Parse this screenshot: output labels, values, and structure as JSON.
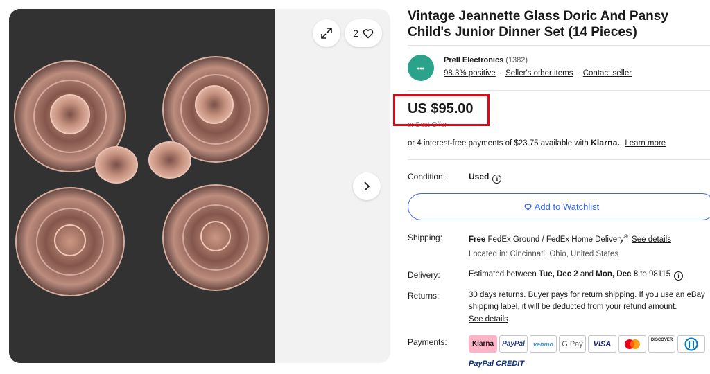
{
  "gallery": {
    "watch_count": "2",
    "icons": {
      "expand": "expand-icon",
      "heart": "heart-icon",
      "next": "chevron-right-icon"
    }
  },
  "listing": {
    "title": "Vintage Jeannette Glass Doric And Pansy Child's Junior Dinner Set (14 Pieces)"
  },
  "seller": {
    "name": "Prell Electronics",
    "feedback_count": "(1382)",
    "positive": "98.3% positive",
    "other_items": "Seller's other items",
    "contact": "Contact seller",
    "separator": "·"
  },
  "price": {
    "amount": "US $95.00",
    "best_offer": "or Best Offer",
    "klarna_text": "or 4 interest-free payments of $23.75 available with",
    "klarna_brand": "Klarna.",
    "learn_more": "Learn more",
    "highlight_color": "#e30613"
  },
  "condition": {
    "label": "Condition:",
    "value": "Used"
  },
  "watchlist": {
    "label": "Add to Watchlist",
    "color": "#3665f3"
  },
  "shipping": {
    "label": "Shipping:",
    "free": "Free",
    "method": "FedEx Ground / FedEx Home Delivery",
    "reg": "®.",
    "details_link": "See details",
    "location": "Located in: Cincinnati, Ohio, United States"
  },
  "delivery": {
    "label": "Delivery:",
    "prefix": "Estimated between",
    "start": "Tue, Dec 2",
    "and": "and",
    "end": "Mon, Dec 8",
    "to": "to 98115"
  },
  "returns": {
    "label": "Returns:",
    "line1": "30 days returns. Buyer pays for return shipping. If you use an eBay",
    "line2": "shipping label, it will be deducted from your refund amount.",
    "details_link": "See details"
  },
  "payments": {
    "label": "Payments:",
    "methods": [
      "Klarna",
      "PayPal",
      "venmo",
      "G Pay",
      "VISA",
      "",
      "DISCOVER",
      ""
    ],
    "credit": "PayPal CREDIT"
  }
}
